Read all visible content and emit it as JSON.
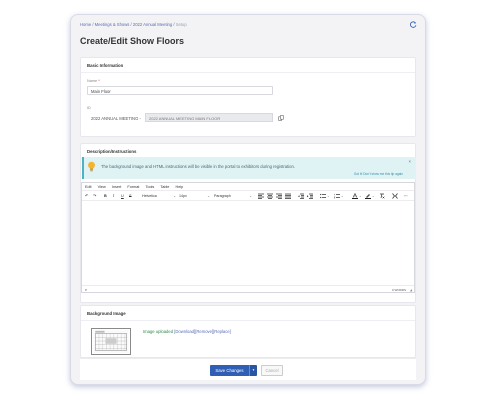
{
  "breadcrumb": {
    "items": [
      "Home",
      "Meetings & Shows",
      "2022 Annual Meeting"
    ],
    "separator": " / ",
    "current": "Setup"
  },
  "page": {
    "title": "Create/Edit Show Floors"
  },
  "basic": {
    "title": "Basic Information",
    "name_label": "Name",
    "required_mark": "*",
    "name_value": "Main Floor",
    "id_label": "ID",
    "id_prefix": "2022 ANNUAL MEETING -",
    "id_value": "2022 ANNUAL MEETING MAIN FLOOR"
  },
  "description": {
    "title": "Description/Instructions",
    "info_text": "The background image and HTML instructions will be visible in the portal to exhibitors during registration.",
    "info_close": "×",
    "info_dismiss": "Got it! Don't show me this tip again",
    "menu": [
      "Edit",
      "View",
      "Insert",
      "Format",
      "Tools",
      "Table",
      "Help"
    ],
    "font_family": "Helvetica",
    "font_size": "14px",
    "block_format": "Paragraph",
    "status_path": "P",
    "status_words": "0 WORDS"
  },
  "background": {
    "title": "Background Image",
    "status": "Image uploaded",
    "download": "Download",
    "remove": "Remove",
    "replace": "Replace"
  },
  "footer": {
    "save_label": "Save Changes",
    "cancel_label": "Cancel"
  },
  "colors": {
    "primary": "#2f5fb5",
    "link": "#5a6db0",
    "success": "#2f8a4a",
    "info_bg": "#dff2f4"
  }
}
